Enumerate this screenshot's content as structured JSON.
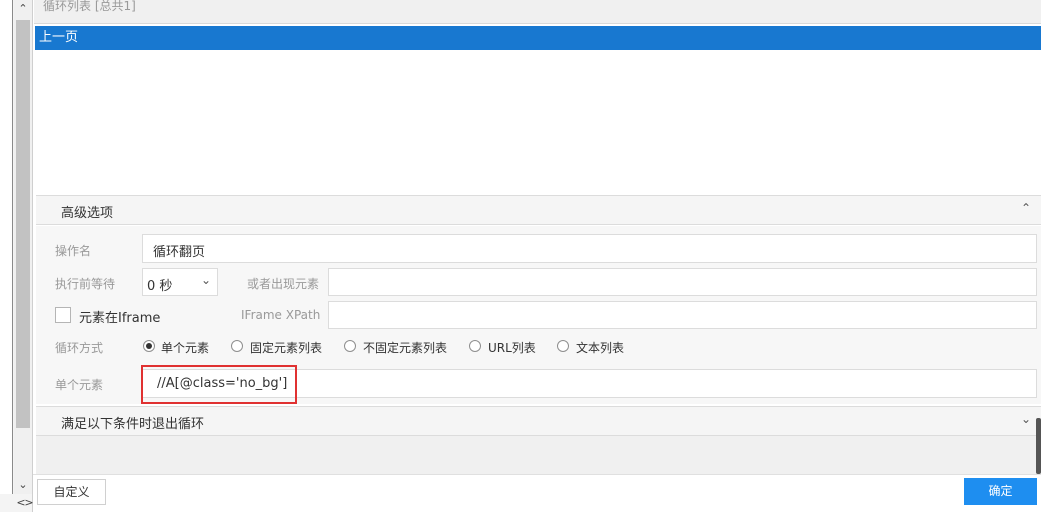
{
  "left_scroll": {
    "up_arrow": "^",
    "down_arrow": "v",
    "left_arrow": "<",
    "right_arrow": ">"
  },
  "list": {
    "title": "循环列表 [总共1]",
    "rows": [
      "上一页"
    ],
    "selected_color": "#1878d0"
  },
  "advanced": {
    "title": "高级选项",
    "collapse_icon": "chevron-up-icon",
    "operation_name_label": "操作名",
    "operation_name_value": "循环翻页",
    "wait_label": "执行前等待",
    "wait_value": "0 秒",
    "or_element_label": "或者出现元素",
    "or_element_value": "",
    "iframe_checkbox_label": "元素在Iframe",
    "iframe_checked": false,
    "iframe_xpath_label": "IFrame XPath",
    "iframe_xpath_value": "",
    "loop_mode_label": "循环方式",
    "loop_modes": [
      "单个元素",
      "固定元素列表",
      "不固定元素列表",
      "URL列表",
      "文本列表"
    ],
    "loop_mode_selected": "单个元素",
    "single_element_label": "单个元素",
    "single_element_value": "//A[@class='no_bg']",
    "highlight_color": "#e03131"
  },
  "exit_section": {
    "title": "满足以下条件时退出循环",
    "expand_icon": "chevron-down-icon"
  },
  "footer": {
    "custom_label": "自定义",
    "ok_label": "确定",
    "ok_color": "#1e8ef0"
  }
}
